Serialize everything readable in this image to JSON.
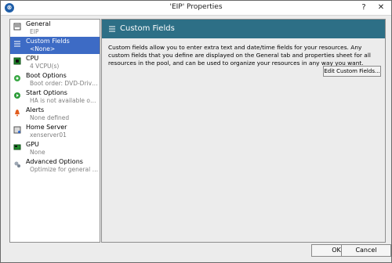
{
  "window": {
    "title": "'EIP' Properties",
    "help_symbol": "?",
    "close_symbol": "✕"
  },
  "sidebar": {
    "items": [
      {
        "label": "General",
        "sub": "EIP",
        "icon": "general-icon"
      },
      {
        "label": "Custom Fields",
        "sub": "<None>",
        "icon": "custom-fields-icon"
      },
      {
        "label": "CPU",
        "sub": "4 VCPU(s)",
        "icon": "cpu-icon"
      },
      {
        "label": "Boot Options",
        "sub": "Boot order: DVD-Drive, H...",
        "icon": "boot-options-icon"
      },
      {
        "label": "Start Options",
        "sub": "HA is not available on sta...",
        "icon": "start-options-icon"
      },
      {
        "label": "Alerts",
        "sub": "None defined",
        "icon": "alerts-icon"
      },
      {
        "label": "Home Server",
        "sub": "xenserver01",
        "icon": "home-server-icon"
      },
      {
        "label": "GPU",
        "sub": "None",
        "icon": "gpu-icon"
      },
      {
        "label": "Advanced Options",
        "sub": "Optimize for general use",
        "icon": "advanced-options-icon"
      }
    ]
  },
  "main": {
    "header_title": "Custom Fields",
    "description": "Custom fields allow you to enter extra text and date/time fields for your resources. Any custom fields that you define are displayed on the General tab and properties sheet for all resources in the pool, and can be used to organize your resources in any way you want.",
    "edit_button": "Edit Custom Fields..."
  },
  "footer": {
    "ok": "OK",
    "cancel": "Cancel"
  },
  "colors": {
    "selected": "#3d6bc5",
    "header": "#2d6f86"
  }
}
